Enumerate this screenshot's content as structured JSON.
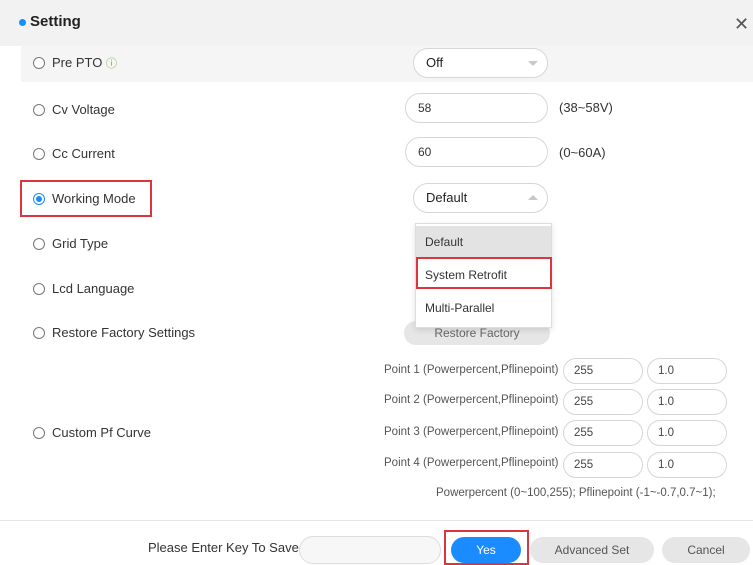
{
  "dialog": {
    "title": "Setting",
    "close_icon": "close-icon"
  },
  "settings": {
    "pre_pto": {
      "label": "Pre PTO",
      "info_glyph": "ⓘ",
      "value": "Off"
    },
    "cv_voltage": {
      "label": "Cv Voltage",
      "value": "58",
      "range": "(38~58V)"
    },
    "cc_current": {
      "label": "Cc Current",
      "value": "60",
      "range": "(0~60A)"
    },
    "working_mode": {
      "label": "Working Mode",
      "value": "Default",
      "selected": true,
      "options": [
        "Default",
        "System Retrofit",
        "Multi-Parallel"
      ]
    },
    "grid_type": {
      "label": "Grid Type"
    },
    "lcd_language": {
      "label": "Lcd Language"
    },
    "restore_factory": {
      "label": "Restore Factory Settings",
      "button": "Restore Factory"
    },
    "custom_pf_curve": {
      "label": "Custom Pf Curve",
      "points": [
        {
          "label": "Point 1 (Powerpercent,Pflinepoint)",
          "power": "255",
          "pf": "1.0"
        },
        {
          "label": "Point 2 (Powerpercent,Pflinepoint)",
          "power": "255",
          "pf": "1.0"
        },
        {
          "label": "Point 3 (Powerpercent,Pflinepoint)",
          "power": "255",
          "pf": "1.0"
        },
        {
          "label": "Point 4 (Powerpercent,Pflinepoint)",
          "power": "255",
          "pf": "1.0"
        }
      ],
      "hint": "Powerpercent (0~100,255);   Pflinepoint (-1~-0.7,0.7~1);"
    }
  },
  "footer": {
    "save_label": "Please Enter Key To Save",
    "key_value": "",
    "yes": "Yes",
    "advanced": "Advanced Set",
    "cancel": "Cancel"
  },
  "colors": {
    "accent": "#1a8cff",
    "highlight": "#d9363e",
    "info": "#69b82f"
  }
}
